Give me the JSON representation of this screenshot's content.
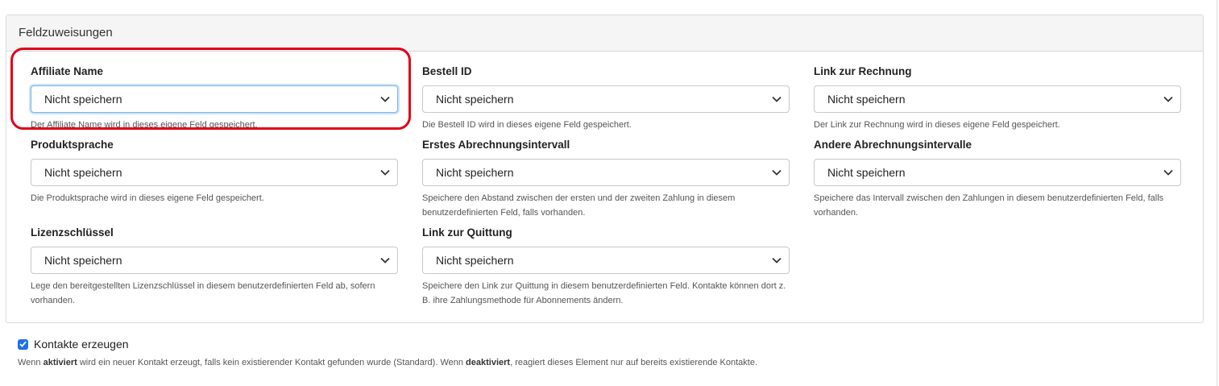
{
  "panel": {
    "title": "Feldzuweisungen",
    "fields": [
      {
        "label": "Affiliate Name",
        "value": "Nicht speichern",
        "help": "Der Affiliate Name wird in dieses eigene Feld gespeichert."
      },
      {
        "label": "Bestell ID",
        "value": "Nicht speichern",
        "help": "Die Bestell ID wird in dieses eigene Feld gespeichert."
      },
      {
        "label": "Link zur Rechnung",
        "value": "Nicht speichern",
        "help": "Der Link zur Rechnung wird in dieses eigene Feld gespeichert."
      },
      {
        "label": "Produktsprache",
        "value": "Nicht speichern",
        "help": "Die Produktsprache wird in dieses eigene Feld gespeichert."
      },
      {
        "label": "Erstes Abrechnungsintervall",
        "value": "Nicht speichern",
        "help": "Speichere den Abstand zwischen der ersten und der zweiten Zahlung in diesem benutzerdefinierten Feld, falls vorhanden."
      },
      {
        "label": "Andere Abrechnungsintervalle",
        "value": "Nicht speichern",
        "help": "Speichere das Intervall zwischen den Zahlungen in diesem benutzerdefinierten Feld, falls vorhanden."
      },
      {
        "label": "Lizenzschlüssel",
        "value": "Nicht speichern",
        "help": "Lege den bereitgestellten Lizenzschlüssel in diesem benutzerdefinierten Feld ab, sofern vorhanden."
      },
      {
        "label": "Link zur Quittung",
        "value": "Nicht speichern",
        "help": "Speichere den Link zur Quittung in diesem benutzerdefinierten Feld. Kontakte können dort z. B. ihre Zahlungsmethode für Abonnements ändern."
      }
    ]
  },
  "contacts": {
    "label": "Kontakte erzeugen",
    "checked": true,
    "help_1": "Wenn ",
    "help_bold_1": "aktiviert",
    "help_2": " wird ein neuer Kontakt erzeugt, falls kein existierender Kontakt gefunden wurde (Standard). Wenn ",
    "help_bold_2": "deaktiviert",
    "help_3": ", reagiert dieses Element nur auf bereits existierende Kontakte."
  },
  "colors": {
    "highlight": "#e0001b",
    "checkbox": "#1a73e8",
    "focus": "#7fb5e6"
  },
  "icons": {
    "select": "chevron-down-icon",
    "checkbox": "checkmark-icon"
  }
}
